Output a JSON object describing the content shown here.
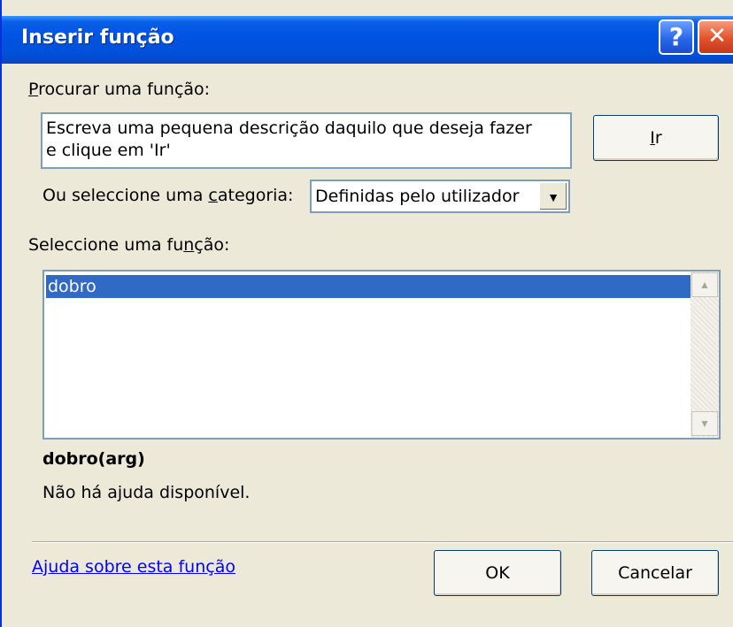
{
  "window": {
    "title": "Inserir função",
    "help_button": "?",
    "close_button": "✕"
  },
  "search": {
    "label_underlined": "P",
    "label_rest": "rocurar uma função:",
    "input_value": "Escreva uma pequena descrição daquilo que deseja fazer\ne clique em 'Ir'",
    "go_button_underlined": "I",
    "go_button_rest": "r"
  },
  "category": {
    "label_before": "Ou seleccione uma ",
    "label_underlined": "c",
    "label_after": "ategoria:",
    "selected": "Definidas pelo utilizador"
  },
  "function_list": {
    "label_before": "Seleccione uma fu",
    "label_underlined": "n",
    "label_after": "ção:",
    "items": [
      "dobro"
    ],
    "selected_index": 0
  },
  "description": {
    "signature": "dobro(arg)",
    "text": "Não há ajuda disponível."
  },
  "footer": {
    "help_link": "Ajuda sobre esta função",
    "ok_label": "OK",
    "cancel_label": "Cancelar"
  }
}
